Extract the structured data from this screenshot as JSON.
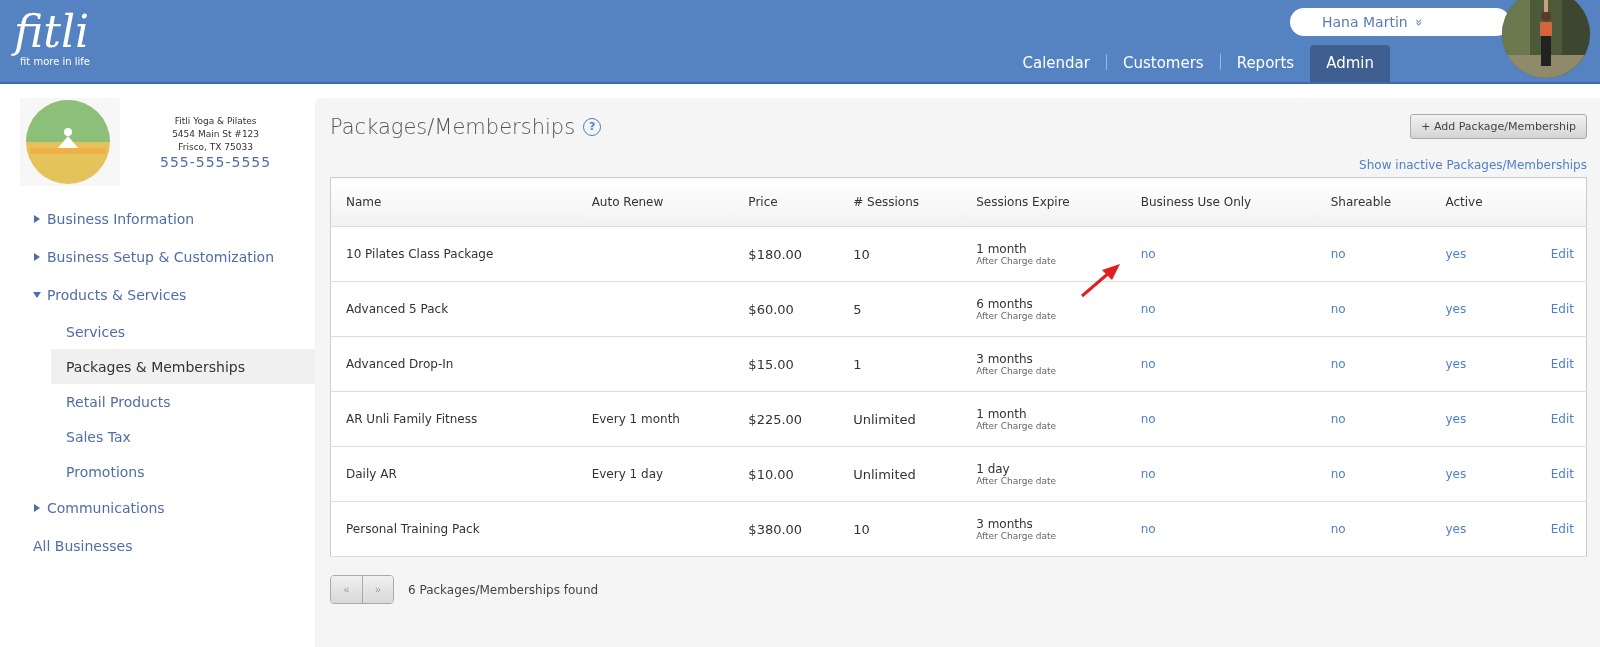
{
  "header": {
    "logo": "fitli",
    "tagline": "fit more in life",
    "user": {
      "name": "Hana Martin",
      "menu_glyph": "»"
    },
    "nav": [
      {
        "label": "Calendar",
        "selected": false
      },
      {
        "label": "Customers",
        "selected": false
      },
      {
        "label": "Reports",
        "selected": false
      },
      {
        "label": "Admin",
        "selected": true
      }
    ]
  },
  "business": {
    "name": "Fitli Yoga & Pilates",
    "address": "5454 Main St #123",
    "city": "Frisco, TX 75033",
    "phone": "555-555-5555"
  },
  "sidebar": {
    "items": [
      {
        "label": "Business Information",
        "kind": "group",
        "expanded": false
      },
      {
        "label": "Business Setup & Customization",
        "kind": "group",
        "expanded": false
      },
      {
        "label": "Products & Services",
        "kind": "group",
        "expanded": true,
        "children": [
          {
            "label": "Services",
            "selected": false
          },
          {
            "label": "Packages & Memberships",
            "selected": true
          },
          {
            "label": "Retail Products",
            "selected": false
          },
          {
            "label": "Sales Tax",
            "selected": false
          },
          {
            "label": "Promotions",
            "selected": false
          }
        ]
      },
      {
        "label": "Communications",
        "kind": "group",
        "expanded": false
      },
      {
        "label": "All Businesses",
        "kind": "link"
      }
    ]
  },
  "page": {
    "title": "Packages/Memberships",
    "help_glyph": "?",
    "add_button": "+ Add Package/Membership",
    "inactive_link": "Show inactive Packages/Memberships"
  },
  "table": {
    "columns": [
      "Name",
      "Auto Renew",
      "Price",
      "# Sessions",
      "Sessions Expire",
      "Business Use Only",
      "Shareable",
      "Active"
    ],
    "rows": [
      {
        "name": "10 Pilates Class Package",
        "auto_renew": "",
        "price": "$180.00",
        "sessions": "10",
        "expire": "1 month",
        "expire_note": "After Charge date",
        "business_use": "no",
        "shareable": "no",
        "active": "yes",
        "action": "Edit"
      },
      {
        "name": "Advanced 5 Pack",
        "auto_renew": "",
        "price": "$60.00",
        "sessions": "5",
        "expire": "6 months",
        "expire_note": "After Charge date",
        "business_use": "no",
        "shareable": "no",
        "active": "yes",
        "action": "Edit"
      },
      {
        "name": "Advanced Drop-In",
        "auto_renew": "",
        "price": "$15.00",
        "sessions": "1",
        "expire": "3 months",
        "expire_note": "After Charge date",
        "business_use": "no",
        "shareable": "no",
        "active": "yes",
        "action": "Edit"
      },
      {
        "name": "AR Unli Family Fitness",
        "auto_renew": "Every 1 month",
        "price": "$225.00",
        "sessions": "Unlimited",
        "expire": "1 month",
        "expire_note": "After Charge date",
        "business_use": "no",
        "shareable": "no",
        "active": "yes",
        "action": "Edit"
      },
      {
        "name": "Daily AR",
        "auto_renew": "Every 1 day",
        "price": "$10.00",
        "sessions": "Unlimited",
        "expire": "1 day",
        "expire_note": "After Charge date",
        "business_use": "no",
        "shareable": "no",
        "active": "yes",
        "action": "Edit"
      },
      {
        "name": "Personal Training Pack",
        "auto_renew": "",
        "price": "$380.00",
        "sessions": "10",
        "expire": "3 months",
        "expire_note": "After Charge date",
        "business_use": "no",
        "shareable": "no",
        "active": "yes",
        "action": "Edit"
      }
    ]
  },
  "pager": {
    "prev": "«",
    "next": "»",
    "summary": "6 Packages/Memberships found"
  }
}
